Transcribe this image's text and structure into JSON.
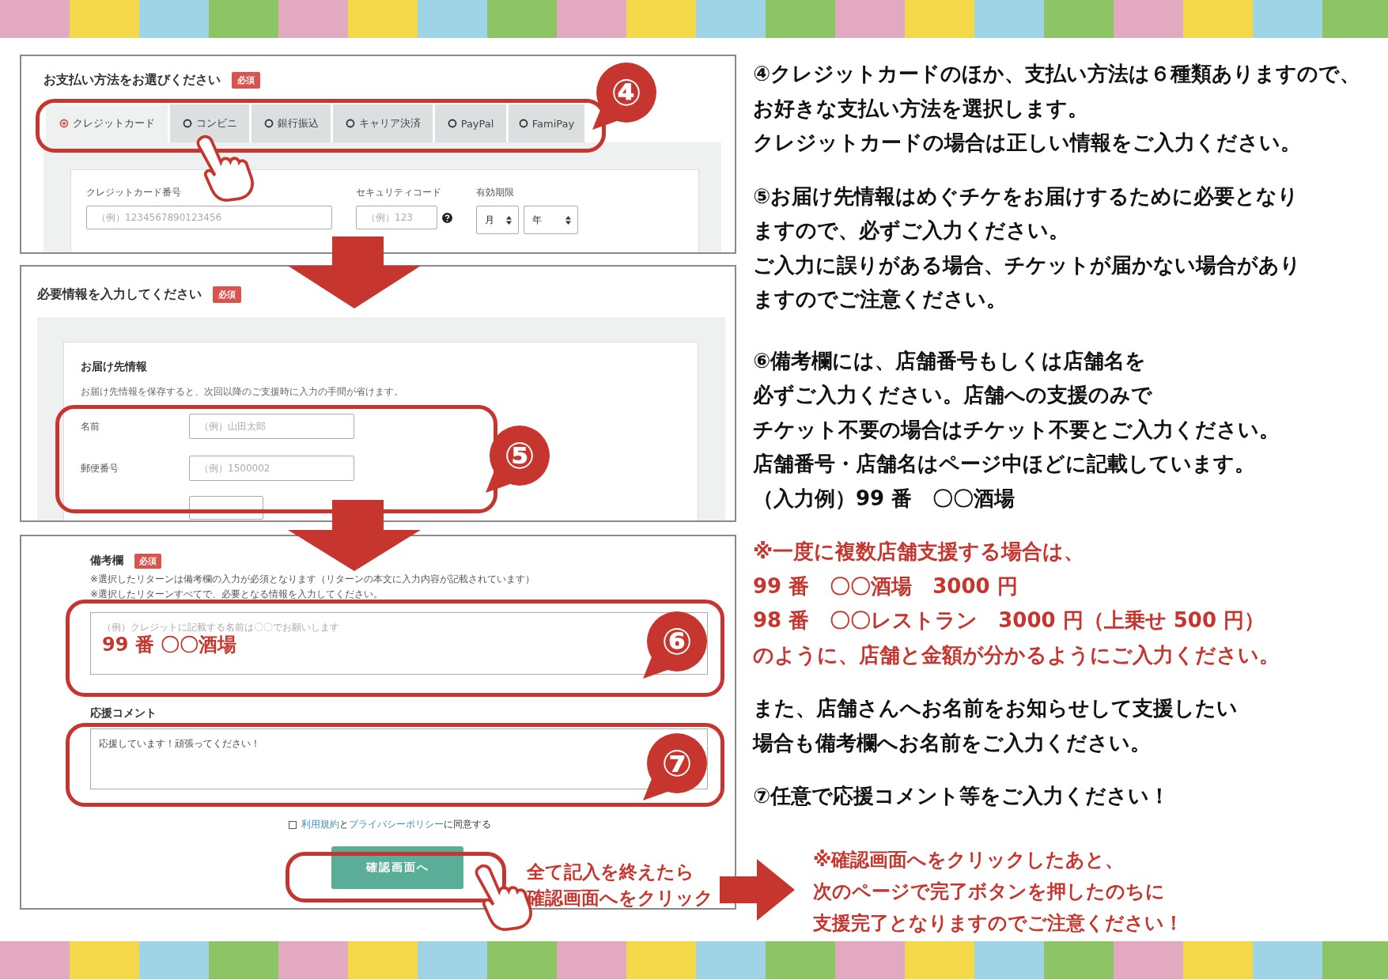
{
  "payment": {
    "title": "お支払い方法をお選びください",
    "badge": "必須",
    "tabs": [
      {
        "label": "クレジットカード",
        "selected": true
      },
      {
        "label": "コンビニ",
        "selected": false
      },
      {
        "label": "銀行振込",
        "selected": false
      },
      {
        "label": "キャリア決済",
        "selected": false
      },
      {
        "label": "PayPal",
        "selected": false
      },
      {
        "label": "FamiPay",
        "selected": false
      }
    ],
    "card_number": {
      "label": "クレジットカード番号",
      "placeholder": "（例）1234567890123456"
    },
    "security_code": {
      "label": "セキュリティコード",
      "placeholder": "（例）123"
    },
    "expiry": {
      "label": "有効期限",
      "selects": [
        "月",
        "年"
      ]
    }
  },
  "delivery": {
    "title": "必要情報を入力してください",
    "badge": "必須",
    "section": "お届け先情報",
    "description": "お届け先情報を保存すると、次回以降のご支援時に入力の手間が省けます。",
    "fields": [
      {
        "label": "名前",
        "placeholder": "（例）山田太郎"
      },
      {
        "label": "郵便番号",
        "placeholder": "（例）1500002"
      }
    ]
  },
  "remarks": {
    "label": "備考欄",
    "badge": "必須",
    "notes": [
      "※選択したリターンは備考欄の入力が必須となります（リターンの本文に入力内容が記載されています）",
      "※選択したリターンすべてで、必要となる情報を入力してください。"
    ],
    "placeholder": "（例）クレジットに記載する名前は〇〇でお願いします",
    "example": "99 番  〇〇酒場"
  },
  "comment": {
    "label": "応援コメント",
    "value": "応援しています！頑張ってください！"
  },
  "agreement": {
    "checked": false,
    "terms_link": "利用規約",
    "joiner": "と",
    "privacy_link": "プライバシーポリシー",
    "suffix": "に同意する"
  },
  "submit": {
    "label": "確認画面へ"
  },
  "callouts": [
    "④",
    "⑤",
    "⑥",
    "⑦"
  ],
  "hint": [
    "全て記入を終えたら",
    "確認画面へをクリック"
  ],
  "guide": [
    {
      "kind": "normal",
      "lines": [
        "④クレジットカードのほか、支払い方法は６種類ありますので、",
        "お好きな支払い方法を選択します。",
        "クレジットカードの場合は正しい情報をご入力ください。"
      ]
    },
    {
      "kind": "normal",
      "lines": [
        "⑤お届け先情報はめぐチケをお届けするために必要となり",
        "ますので、必ずご入力ください。",
        "ご入力に誤りがある場合、チケットが届かない場合があり",
        "ますのでご注意ください。"
      ]
    },
    {
      "kind": "normal",
      "lines": [
        "⑥備考欄には、店舗番号もしくは店舗名を",
        "必ずご入力ください。店舗への支援のみで",
        "チケット不要の場合はチケット不要とご入力ください。",
        "店舗番号・店舗名はページ中ほどに記載しています。",
        "（入力例）99 番　〇〇酒場"
      ]
    },
    {
      "kind": "warning",
      "lines": [
        "※一度に複数店舗支援する場合は、",
        "99 番　〇〇酒場　3000 円",
        "98 番　〇〇レストラン　3000 円（上乗せ 500 円）",
        "のように、店舗と金額が分かるようにご入力ください。"
      ]
    },
    {
      "kind": "normal",
      "lines": [
        "また、店舗さんへお名前をお知らせして支援したい",
        "場合も備考欄へお名前をご入力ください。"
      ]
    },
    {
      "kind": "normal",
      "lines": [
        "⑦任意で応援コメント等をご入力ください！"
      ]
    }
  ],
  "notice": [
    "※確認画面へをクリックしたあと、",
    "次のページで完了ボタンを押したのちに",
    "支援完了となりますのでご注意ください！"
  ]
}
